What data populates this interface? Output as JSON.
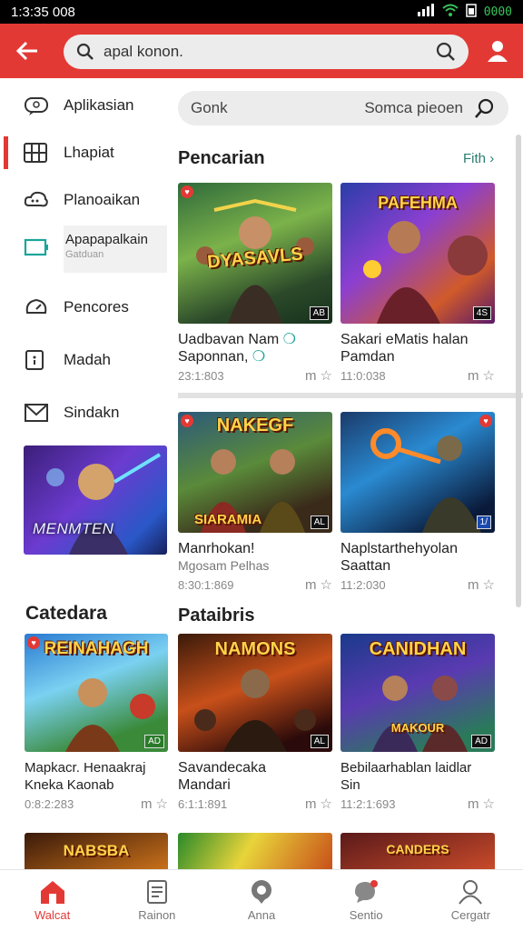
{
  "status_bar": {
    "time": "1:3:35 008",
    "battery": "0000"
  },
  "top_bar": {
    "search_text": "apal konon."
  },
  "drawer": {
    "items": [
      {
        "label": "Aplikasian",
        "icon": "chat-icon"
      },
      {
        "label": "Lhapiat",
        "icon": "grid-icon"
      },
      {
        "label": "Planoaikan",
        "icon": "cloud-chat-icon"
      },
      {
        "label": "Apapapalkain",
        "sub": "Gatduan",
        "icon": "tablet-icon"
      },
      {
        "label": "Pencores",
        "icon": "speedometer-icon"
      },
      {
        "label": "Madah",
        "icon": "info-box-icon"
      },
      {
        "label": "Sindakn",
        "icon": "mail-icon"
      }
    ],
    "banner_text": "MENMTEN"
  },
  "inner_search": {
    "left_text": "Gonk",
    "right_text": "Somca pieoen"
  },
  "sections": [
    {
      "title": "Pencarian",
      "more": "Fith"
    },
    {
      "title": "Pataibris"
    },
    {
      "title": "Catedara"
    }
  ],
  "cards_row1": [
    {
      "art": "DYASAVLS",
      "badge": "AB",
      "name1": "Uadbavan Nam",
      "name2": "Saponnan,",
      "meta": "23:1:803"
    },
    {
      "art": "PAFEHMA",
      "badge": "4S",
      "name1": "Sakari eMatis halan",
      "name2": "Pamdan",
      "meta": "11:0:038"
    }
  ],
  "cards_row2": [
    {
      "art": "NAKEGF",
      "art2": "SIARAMIA",
      "badge": "AL",
      "name1": "Manrhokan!",
      "name2": "Mgosam Pelhas",
      "meta": "8:30:1:869"
    },
    {
      "art": "",
      "badge": "1/",
      "name1": "Naplstarthehyolan",
      "name2": "Saattan",
      "meta": "11:2:030"
    }
  ],
  "cards_row3": [
    {
      "art": "REINAHAGH",
      "badge": "AD",
      "name1": "Mapkacr. Henaakraj",
      "name2": "Kneka Kaonab",
      "meta": "0:8:2:283"
    },
    {
      "art": "NAMONS",
      "badge": "AL",
      "name1": "Savandecaka",
      "name2": "Mandari",
      "meta": "6:1:1:891"
    },
    {
      "art": "CANIDHAN",
      "art2": "MAKOUR",
      "badge": "AD",
      "name1": "Bebilaarhablan laidlar",
      "name2": "Sin",
      "meta": "11:2:1:693"
    }
  ],
  "strip_titles": [
    "NABSBA",
    "",
    "CANDERS"
  ],
  "bottom_nav": [
    {
      "label": "Walcat",
      "icon": "home-icon"
    },
    {
      "label": "Rainon",
      "icon": "document-icon"
    },
    {
      "label": "Anna",
      "icon": "location-icon"
    },
    {
      "label": "Sentio",
      "icon": "chat-bubble-icon"
    },
    {
      "label": "Cergatr",
      "icon": "person-icon"
    }
  ],
  "colors": {
    "accent": "#e33935",
    "link": "#2a7d6f"
  }
}
